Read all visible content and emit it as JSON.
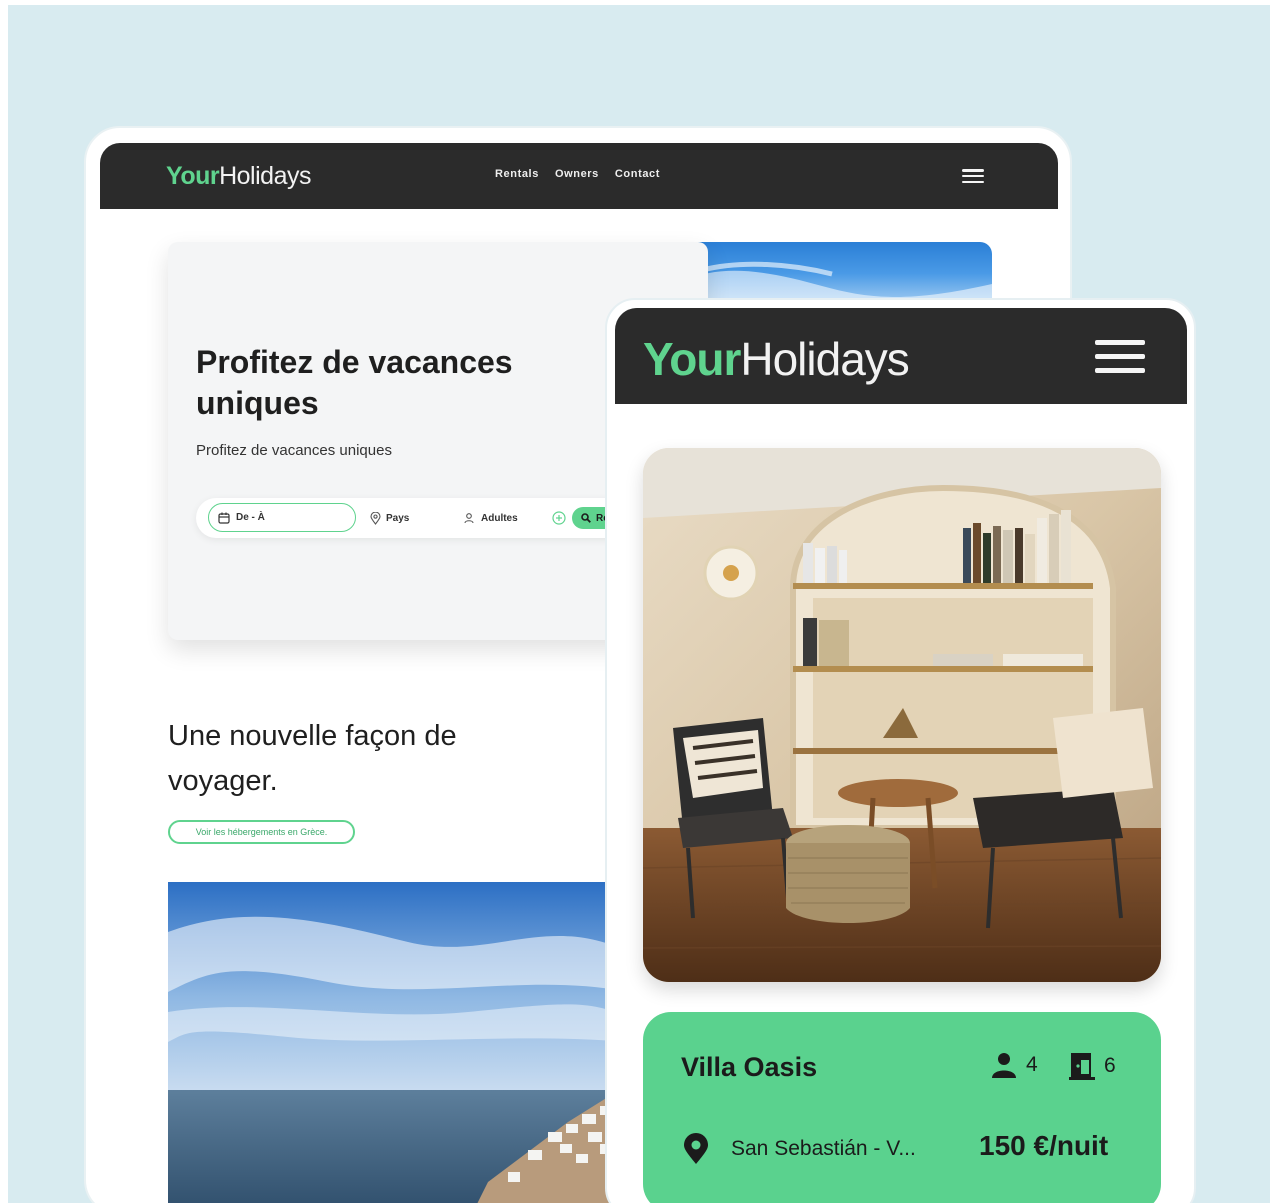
{
  "desktop": {
    "logo": {
      "part1": "Your",
      "part2": "Holidays"
    },
    "nav": {
      "rentals": "Rentals",
      "owners": "Owners",
      "contact": "Contact"
    },
    "hero": {
      "title": "Profitez de vacances uniques",
      "subtitle": "Profitez de vacances uniques",
      "search": {
        "dates_label": "De - À",
        "country_label": "Pays",
        "guests_label": "Adultes",
        "button_label": "Re"
      }
    },
    "section": {
      "title": "Une nouvelle façon de voyager.",
      "cta_label": "Voir les hébergements en Grèce."
    }
  },
  "mobile": {
    "logo": {
      "part1": "Your",
      "part2": "Holidays"
    },
    "listing": {
      "name": "Villa Oasis",
      "guests": "4",
      "rooms": "6",
      "location": "San Sebastián - V...",
      "price": "150 €/nuit"
    }
  },
  "icons": {
    "menu": "hamburger-menu-icon",
    "calendar": "calendar-icon",
    "location": "map-pin-icon",
    "guests": "person-icon",
    "add": "plus-circle-icon",
    "search": "search-icon",
    "rooms": "door-icon"
  },
  "colors": {
    "background": "#d8ebf0",
    "navbar": "#2b2b2b",
    "accent": "#5fd38e",
    "card_green": "#5ad28e"
  }
}
